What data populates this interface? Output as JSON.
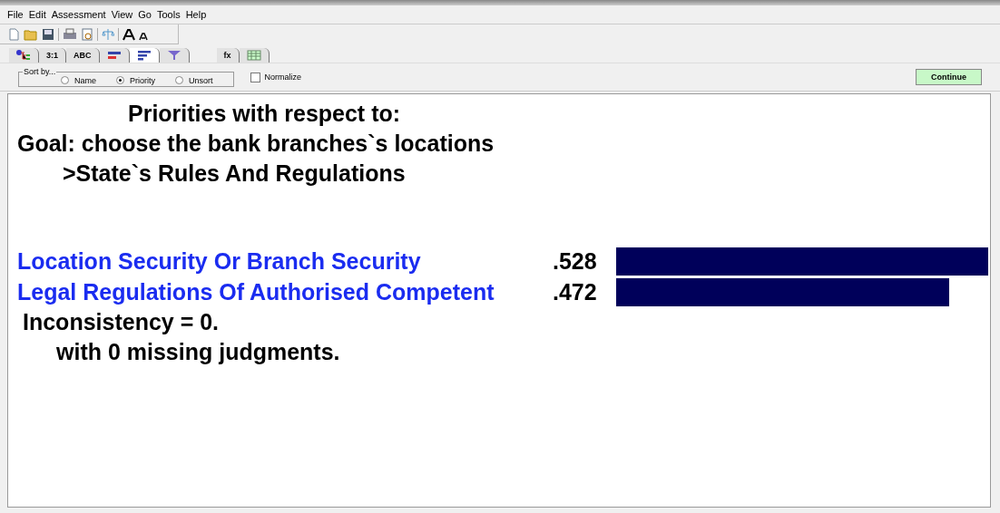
{
  "menu": [
    "File",
    "Edit",
    "Assessment",
    "View",
    "Go",
    "Tools",
    "Help"
  ],
  "tabs": [
    {
      "kind": "tree",
      "selected": false
    },
    {
      "kind": "text",
      "label": "3:1",
      "selected": false
    },
    {
      "kind": "text",
      "label": "ABC",
      "selected": false
    },
    {
      "kind": "bars",
      "selected": false
    },
    {
      "kind": "sorted",
      "selected": true
    },
    {
      "kind": "funnel",
      "selected": false
    },
    {
      "kind": "text",
      "label": "fx",
      "selected": false
    },
    {
      "kind": "grid",
      "selected": false
    }
  ],
  "sort_by": {
    "title": "Sort by...",
    "options": [
      {
        "label": "Name",
        "selected": false
      },
      {
        "label": "Priority",
        "selected": true
      },
      {
        "label": "Unsort",
        "selected": false
      }
    ]
  },
  "normalize": {
    "label": "Normalize",
    "checked": false
  },
  "continue_button": "Continue",
  "heading": [
    "Priorities with respect to:",
    "Goal: choose  the bank branches`s locations",
    ">State`s Rules And Regulations"
  ],
  "priorities": [
    {
      "name": "Location Security Or Branch Security",
      "value": ".528"
    },
    {
      "name": "Legal Regulations Of Authorised Competent",
      "value": ".472"
    }
  ],
  "inconsistency": "Inconsistency = 0.",
  "missing": "with 0  missing judgments."
}
